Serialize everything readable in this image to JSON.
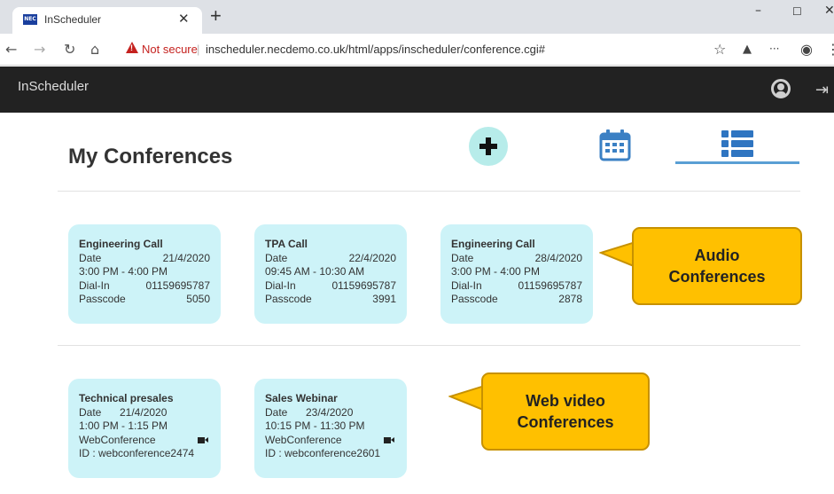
{
  "browser": {
    "tab_title": "InScheduler",
    "tab_favicon_text": "NEC",
    "security_label": "Not secure",
    "url": "inscheduler.necdemo.co.uk/html/apps/inscheduler/conference.cgi#"
  },
  "app": {
    "title": "InScheduler"
  },
  "page": {
    "title": "My Conferences"
  },
  "audio_conferences": [
    {
      "title": "Engineering Call",
      "date_label": "Date",
      "date": "21/4/2020",
      "time": "3:00 PM - 4:00 PM",
      "dialin_label": "Dial-In",
      "dialin": "01159695787",
      "passcode_label": "Passcode",
      "passcode": "5050"
    },
    {
      "title": "TPA Call",
      "date_label": "Date",
      "date": "22/4/2020",
      "time": "09:45 AM - 10:30 AM",
      "dialin_label": "Dial-In",
      "dialin": "01159695787",
      "passcode_label": "Passcode",
      "passcode": "3991"
    },
    {
      "title": "Engineering Call",
      "date_label": "Date",
      "date": "28/4/2020",
      "time": "3:00 PM - 4:00 PM",
      "dialin_label": "Dial-In",
      "dialin": "01159695787",
      "passcode_label": "Passcode",
      "passcode": "2878"
    }
  ],
  "web_conferences": [
    {
      "title": "Technical presales",
      "date_label": "Date",
      "date": "21/4/2020",
      "time": "1:00 PM - 1:15 PM",
      "type": "WebConference",
      "id": "ID : webconference2474"
    },
    {
      "title": "Sales Webinar",
      "date_label": "Date",
      "date": "23/4/2020",
      "time": "10:15 PM - 11:30 PM",
      "type": "WebConference",
      "id": "ID : webconference2601"
    }
  ],
  "callouts": {
    "audio_line1": "Audio",
    "audio_line2": "Conferences",
    "web_line1": "Web video",
    "web_line2": "Conferences"
  },
  "colors": {
    "card_bg": "#cdf3f8",
    "callout_bg": "#ffc000",
    "header_bg": "#222222",
    "accent": "#5a9fd4"
  }
}
